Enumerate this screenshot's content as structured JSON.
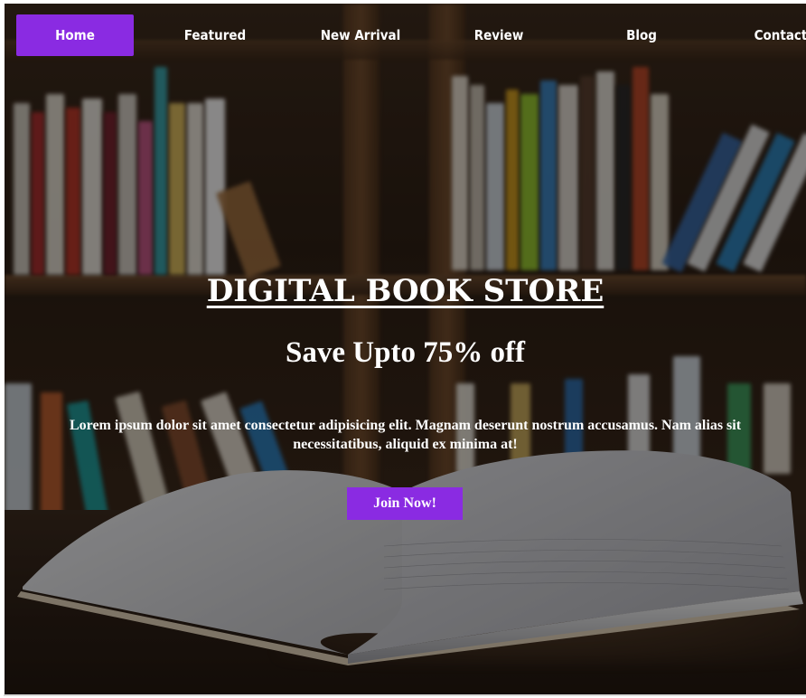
{
  "nav": {
    "items": [
      {
        "label": "Home",
        "active": true
      },
      {
        "label": "Featured",
        "active": false
      },
      {
        "label": "New Arrival",
        "active": false
      },
      {
        "label": "Review",
        "active": false
      },
      {
        "label": "Blog",
        "active": false
      },
      {
        "label": "Contact",
        "active": false
      }
    ]
  },
  "hero": {
    "title": "DIGITAL BOOK STORE",
    "subtitle": "Save Upto 75% off",
    "description": "Lorem ipsum dolor sit amet consectetur adipisicing elit. Magnam deserunt nostrum accusamus. Nam alias sit necessitatibus, aliquid ex minima at!",
    "cta_label": "Join Now!",
    "background_image": "blurred-bookshelf-with-open-book-photo"
  },
  "colors": {
    "accent": "#8a2be2",
    "text": "#ffffff"
  }
}
